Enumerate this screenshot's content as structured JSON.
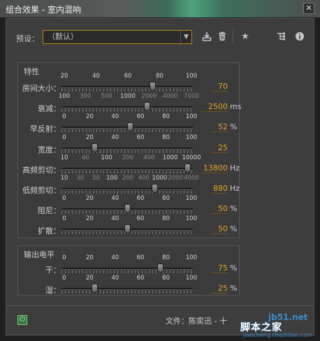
{
  "window": {
    "title": "组合效果 - 室内混响",
    "close_glyph": "✕"
  },
  "preset": {
    "label": "预设：",
    "value": "（默认）"
  },
  "toolbar": {
    "icons": [
      "save-preset-icon",
      "delete-preset-icon",
      "favorite-star-icon",
      "routing-icon",
      "info-icon"
    ]
  },
  "properties": {
    "title": "特性",
    "rows": [
      {
        "label": "房间大小：",
        "scale": [
          "20",
          "40",
          "60",
          "80",
          "100"
        ],
        "value": "70",
        "unit": "",
        "fraction": 0.69
      },
      {
        "label": "衰减：",
        "scale": [
          "100",
          "300",
          "500",
          "1000",
          "2000",
          "4000",
          "7000"
        ],
        "scale_dim": [
          false,
          true,
          true,
          false,
          true,
          true,
          true
        ],
        "value": "2500",
        "unit": "ms",
        "fraction": 0.65
      },
      {
        "label": "早反射：",
        "scale": [
          "0",
          "20",
          "40",
          "60",
          "80",
          "100"
        ],
        "value": "52",
        "unit": "%",
        "fraction": 0.52
      },
      {
        "label": "宽度：",
        "scale": [
          "0",
          "20",
          "40",
          "60",
          "80",
          "100"
        ],
        "value": "25",
        "unit": "",
        "fraction": 0.25
      },
      {
        "label": "高频剪切：",
        "scale": [
          "10",
          "40",
          "100",
          "200",
          "400",
          "1000",
          "10000"
        ],
        "scale_dim": [
          false,
          true,
          false,
          true,
          true,
          false,
          false
        ],
        "value": "13800",
        "unit": "Hz",
        "fraction": 0.96
      },
      {
        "label": "低频剪切：",
        "scale": [
          "10",
          "30",
          "50",
          "100",
          "200",
          "400",
          "1000",
          "2000",
          "4000"
        ],
        "scale_dim": [
          false,
          true,
          true,
          false,
          true,
          true,
          false,
          true,
          true
        ],
        "value": "880",
        "unit": "Hz",
        "fraction": 0.71
      },
      {
        "label": "阻尼：",
        "scale": [
          "0",
          "20",
          "40",
          "60",
          "80",
          "100"
        ],
        "value": "50",
        "unit": "%",
        "fraction": 0.5
      },
      {
        "label": "扩散：",
        "scale": [
          "0",
          "20",
          "40",
          "60",
          "80",
          "100"
        ],
        "value": "50",
        "unit": "%",
        "fraction": 0.5
      }
    ]
  },
  "output": {
    "title": "输出电平",
    "rows": [
      {
        "label": "干：",
        "scale": [
          "0",
          "20",
          "40",
          "60",
          "80",
          "100"
        ],
        "value": "75",
        "unit": "%",
        "fraction": 0.75
      },
      {
        "label": "湿：",
        "scale": [
          "0",
          "20",
          "40",
          "60",
          "80",
          "100"
        ],
        "value": "25",
        "unit": "%",
        "fraction": 0.25
      }
    ]
  },
  "footer": {
    "power_glyph": "⏻",
    "file_label": "文件：陈奕迅 - 十"
  },
  "watermark": {
    "site": "jb51.net",
    "name": "脚本之家",
    "url": "jiaocheng.chazidian.com"
  },
  "colors": {
    "accent": "#e0a426",
    "value_text": "#e0a426",
    "power_green": "#2f7a3c"
  }
}
